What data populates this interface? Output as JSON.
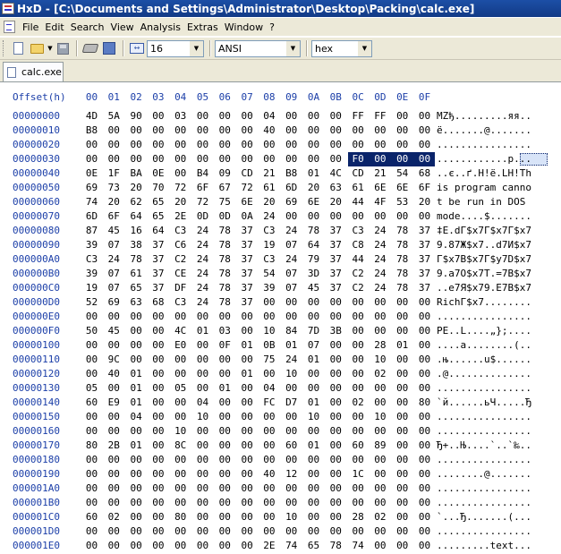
{
  "window": {
    "title": "HxD - [C:\\Documents and Settings\\Administrator\\Desktop\\Packing\\calc.exe]"
  },
  "menu": [
    "File",
    "Edit",
    "Search",
    "View",
    "Analysis",
    "Extras",
    "Window",
    "?"
  ],
  "toolbar": {
    "icons": [
      "new-file-icon",
      "open-file-icon",
      "save-icon",
      "open-disk-icon",
      "open-ram-icon",
      "bytes-per-row-icon"
    ],
    "bytes_per_row": "16",
    "charset": "ANSI",
    "offset_base": "hex"
  },
  "tab": {
    "label": "calc.exe"
  },
  "editor": {
    "offset_header": "Offset(h)",
    "column_headers": [
      "00",
      "01",
      "02",
      "03",
      "04",
      "05",
      "06",
      "07",
      "08",
      "09",
      "0A",
      "0B",
      "0C",
      "0D",
      "0E",
      "0F"
    ],
    "selection_color": "#0a246a",
    "rows": [
      {
        "offset": "00000000",
        "bytes": [
          "4D",
          "5A",
          "90",
          "00",
          "03",
          "00",
          "00",
          "00",
          "04",
          "00",
          "00",
          "00",
          "FF",
          "FF",
          "00",
          "00"
        ],
        "ascii": "MZђ.........яя.."
      },
      {
        "offset": "00000010",
        "bytes": [
          "B8",
          "00",
          "00",
          "00",
          "00",
          "00",
          "00",
          "00",
          "40",
          "00",
          "00",
          "00",
          "00",
          "00",
          "00",
          "00"
        ],
        "ascii": "ё.......@......."
      },
      {
        "offset": "00000020",
        "bytes": [
          "00",
          "00",
          "00",
          "00",
          "00",
          "00",
          "00",
          "00",
          "00",
          "00",
          "00",
          "00",
          "00",
          "00",
          "00",
          "00"
        ],
        "ascii": "................"
      },
      {
        "offset": "00000030",
        "bytes": [
          "00",
          "00",
          "00",
          "00",
          "00",
          "00",
          "00",
          "00",
          "00",
          "00",
          "00",
          "00",
          "F0",
          "00",
          "00",
          "00"
        ],
        "ascii": "............р...",
        "selected_from": 12
      },
      {
        "offset": "00000040",
        "bytes": [
          "0E",
          "1F",
          "BA",
          "0E",
          "00",
          "B4",
          "09",
          "CD",
          "21",
          "B8",
          "01",
          "4C",
          "CD",
          "21",
          "54",
          "68"
        ],
        "ascii": "..є..ґ.Н!ё.LН!Th"
      },
      {
        "offset": "00000050",
        "bytes": [
          "69",
          "73",
          "20",
          "70",
          "72",
          "6F",
          "67",
          "72",
          "61",
          "6D",
          "20",
          "63",
          "61",
          "6E",
          "6E",
          "6F"
        ],
        "ascii": "is program canno"
      },
      {
        "offset": "00000060",
        "bytes": [
          "74",
          "20",
          "62",
          "65",
          "20",
          "72",
          "75",
          "6E",
          "20",
          "69",
          "6E",
          "20",
          "44",
          "4F",
          "53",
          "20"
        ],
        "ascii": "t be run in DOS "
      },
      {
        "offset": "00000070",
        "bytes": [
          "6D",
          "6F",
          "64",
          "65",
          "2E",
          "0D",
          "0D",
          "0A",
          "24",
          "00",
          "00",
          "00",
          "00",
          "00",
          "00",
          "00"
        ],
        "ascii": "mode....$......."
      },
      {
        "offset": "00000080",
        "bytes": [
          "87",
          "45",
          "16",
          "64",
          "C3",
          "24",
          "78",
          "37",
          "C3",
          "24",
          "78",
          "37",
          "C3",
          "24",
          "78",
          "37"
        ],
        "ascii": "‡E.dГ$x7Г$x7Г$x7"
      },
      {
        "offset": "00000090",
        "bytes": [
          "39",
          "07",
          "38",
          "37",
          "C6",
          "24",
          "78",
          "37",
          "19",
          "07",
          "64",
          "37",
          "C8",
          "24",
          "78",
          "37"
        ],
        "ascii": "9.87Ж$x7..d7И$x7"
      },
      {
        "offset": "000000A0",
        "bytes": [
          "C3",
          "24",
          "78",
          "37",
          "C2",
          "24",
          "78",
          "37",
          "C3",
          "24",
          "79",
          "37",
          "44",
          "24",
          "78",
          "37"
        ],
        "ascii": "Г$x7В$x7Г$y7D$x7"
      },
      {
        "offset": "000000B0",
        "bytes": [
          "39",
          "07",
          "61",
          "37",
          "CE",
          "24",
          "78",
          "37",
          "54",
          "07",
          "3D",
          "37",
          "C2",
          "24",
          "78",
          "37"
        ],
        "ascii": "9.a7О$x7T.=7В$x7"
      },
      {
        "offset": "000000C0",
        "bytes": [
          "19",
          "07",
          "65",
          "37",
          "DF",
          "24",
          "78",
          "37",
          "39",
          "07",
          "45",
          "37",
          "C2",
          "24",
          "78",
          "37"
        ],
        "ascii": "..e7Я$x79.E7В$x7"
      },
      {
        "offset": "000000D0",
        "bytes": [
          "52",
          "69",
          "63",
          "68",
          "C3",
          "24",
          "78",
          "37",
          "00",
          "00",
          "00",
          "00",
          "00",
          "00",
          "00",
          "00"
        ],
        "ascii": "RichГ$x7........"
      },
      {
        "offset": "000000E0",
        "bytes": [
          "00",
          "00",
          "00",
          "00",
          "00",
          "00",
          "00",
          "00",
          "00",
          "00",
          "00",
          "00",
          "00",
          "00",
          "00",
          "00"
        ],
        "ascii": "................"
      },
      {
        "offset": "000000F0",
        "bytes": [
          "50",
          "45",
          "00",
          "00",
          "4C",
          "01",
          "03",
          "00",
          "10",
          "84",
          "7D",
          "3B",
          "00",
          "00",
          "00",
          "00"
        ],
        "ascii": "PE..L....„};...."
      },
      {
        "offset": "00000100",
        "bytes": [
          "00",
          "00",
          "00",
          "00",
          "E0",
          "00",
          "0F",
          "01",
          "0B",
          "01",
          "07",
          "00",
          "00",
          "28",
          "01",
          "00"
        ],
        "ascii": "....а........(.."
      },
      {
        "offset": "00000110",
        "bytes": [
          "00",
          "9C",
          "00",
          "00",
          "00",
          "00",
          "00",
          "00",
          "75",
          "24",
          "01",
          "00",
          "00",
          "10",
          "00",
          "00"
        ],
        "ascii": ".њ......u$......"
      },
      {
        "offset": "00000120",
        "bytes": [
          "00",
          "40",
          "01",
          "00",
          "00",
          "00",
          "00",
          "01",
          "00",
          "10",
          "00",
          "00",
          "00",
          "02",
          "00",
          "00"
        ],
        "ascii": ".@.............."
      },
      {
        "offset": "00000130",
        "bytes": [
          "05",
          "00",
          "01",
          "00",
          "05",
          "00",
          "01",
          "00",
          "04",
          "00",
          "00",
          "00",
          "00",
          "00",
          "00",
          "00"
        ],
        "ascii": "................"
      },
      {
        "offset": "00000140",
        "bytes": [
          "60",
          "E9",
          "01",
          "00",
          "00",
          "04",
          "00",
          "00",
          "FC",
          "D7",
          "01",
          "00",
          "02",
          "00",
          "00",
          "80"
        ],
        "ascii": "`й......ьЧ.....Ђ"
      },
      {
        "offset": "00000150",
        "bytes": [
          "00",
          "00",
          "04",
          "00",
          "00",
          "10",
          "00",
          "00",
          "00",
          "00",
          "10",
          "00",
          "00",
          "10",
          "00",
          "00"
        ],
        "ascii": "................"
      },
      {
        "offset": "00000160",
        "bytes": [
          "00",
          "00",
          "00",
          "00",
          "10",
          "00",
          "00",
          "00",
          "00",
          "00",
          "00",
          "00",
          "00",
          "00",
          "00",
          "00"
        ],
        "ascii": "................"
      },
      {
        "offset": "00000170",
        "bytes": [
          "80",
          "2B",
          "01",
          "00",
          "8C",
          "00",
          "00",
          "00",
          "00",
          "60",
          "01",
          "00",
          "60",
          "89",
          "00",
          "00"
        ],
        "ascii": "Ђ+..Њ....`..`‰.."
      },
      {
        "offset": "00000180",
        "bytes": [
          "00",
          "00",
          "00",
          "00",
          "00",
          "00",
          "00",
          "00",
          "00",
          "00",
          "00",
          "00",
          "00",
          "00",
          "00",
          "00"
        ],
        "ascii": "................"
      },
      {
        "offset": "00000190",
        "bytes": [
          "00",
          "00",
          "00",
          "00",
          "00",
          "00",
          "00",
          "00",
          "40",
          "12",
          "00",
          "00",
          "1C",
          "00",
          "00",
          "00"
        ],
        "ascii": "........@......."
      },
      {
        "offset": "000001A0",
        "bytes": [
          "00",
          "00",
          "00",
          "00",
          "00",
          "00",
          "00",
          "00",
          "00",
          "00",
          "00",
          "00",
          "00",
          "00",
          "00",
          "00"
        ],
        "ascii": "................"
      },
      {
        "offset": "000001B0",
        "bytes": [
          "00",
          "00",
          "00",
          "00",
          "00",
          "00",
          "00",
          "00",
          "00",
          "00",
          "00",
          "00",
          "00",
          "00",
          "00",
          "00"
        ],
        "ascii": "................"
      },
      {
        "offset": "000001C0",
        "bytes": [
          "60",
          "02",
          "00",
          "00",
          "80",
          "00",
          "00",
          "00",
          "00",
          "10",
          "00",
          "00",
          "28",
          "02",
          "00",
          "00"
        ],
        "ascii": "`...Ђ.......(..."
      },
      {
        "offset": "000001D0",
        "bytes": [
          "00",
          "00",
          "00",
          "00",
          "00",
          "00",
          "00",
          "00",
          "00",
          "00",
          "00",
          "00",
          "00",
          "00",
          "00",
          "00"
        ],
        "ascii": "................"
      },
      {
        "offset": "000001E0",
        "bytes": [
          "00",
          "00",
          "00",
          "00",
          "00",
          "00",
          "00",
          "00",
          "2E",
          "74",
          "65",
          "78",
          "74",
          "00",
          "00",
          "00"
        ],
        "ascii": ".........text..."
      }
    ]
  }
}
